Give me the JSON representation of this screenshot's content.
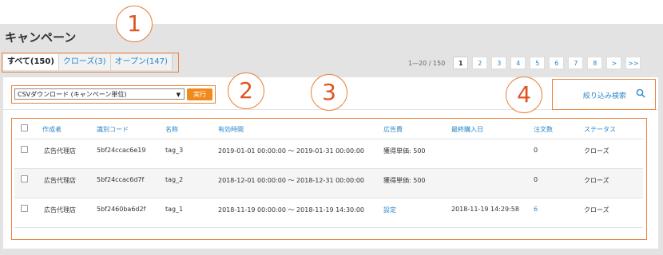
{
  "page_title": "キャンペーン",
  "tabs": [
    {
      "label": "すべて(150)"
    },
    {
      "label": "クローズ(3)"
    },
    {
      "label": "オープン(147)"
    }
  ],
  "pagination": {
    "range": "1—20 / 150",
    "pages": [
      "1",
      "2",
      "3",
      "4",
      "5",
      "6",
      "7",
      "8",
      ">",
      ">>"
    ]
  },
  "toolbar": {
    "csv_select": "CSVダウンロード (キャンペーン単位)",
    "run_label": "実行",
    "search_label": "絞り込み検索"
  },
  "table": {
    "headers": [
      "作成者",
      "識別コード",
      "名称",
      "有効時間",
      "広告費",
      "最終購入日",
      "注文数",
      "ステータス"
    ],
    "rows": [
      [
        "広告代理店",
        "5bf24ccac6e19",
        "tag_3",
        "2019-01-01 00:00:00 〜 2019-01-31 00:00:00",
        "獲得単価: 500",
        "",
        "0",
        "クローズ"
      ],
      [
        "広告代理店",
        "5bf24ccac6d7f",
        "tag_2",
        "2018-12-01 00:00:00 〜 2018-12-31 00:00:00",
        "獲得単価: 500",
        "",
        "0",
        "クローズ"
      ],
      [
        "広告代理店",
        "5bf2460ba6d2f",
        "tag_1",
        "2018-11-19 00:00:00 〜 2018-11-19 14:30:00",
        "設定",
        "2018-11-19 14:29:58",
        "6",
        "クローズ"
      ]
    ]
  },
  "annotations": [
    "1",
    "2",
    "3",
    "4"
  ],
  "colors": {
    "accent": "#2c86c8",
    "button": "#f18a1d",
    "annotation": "#e8823c"
  }
}
